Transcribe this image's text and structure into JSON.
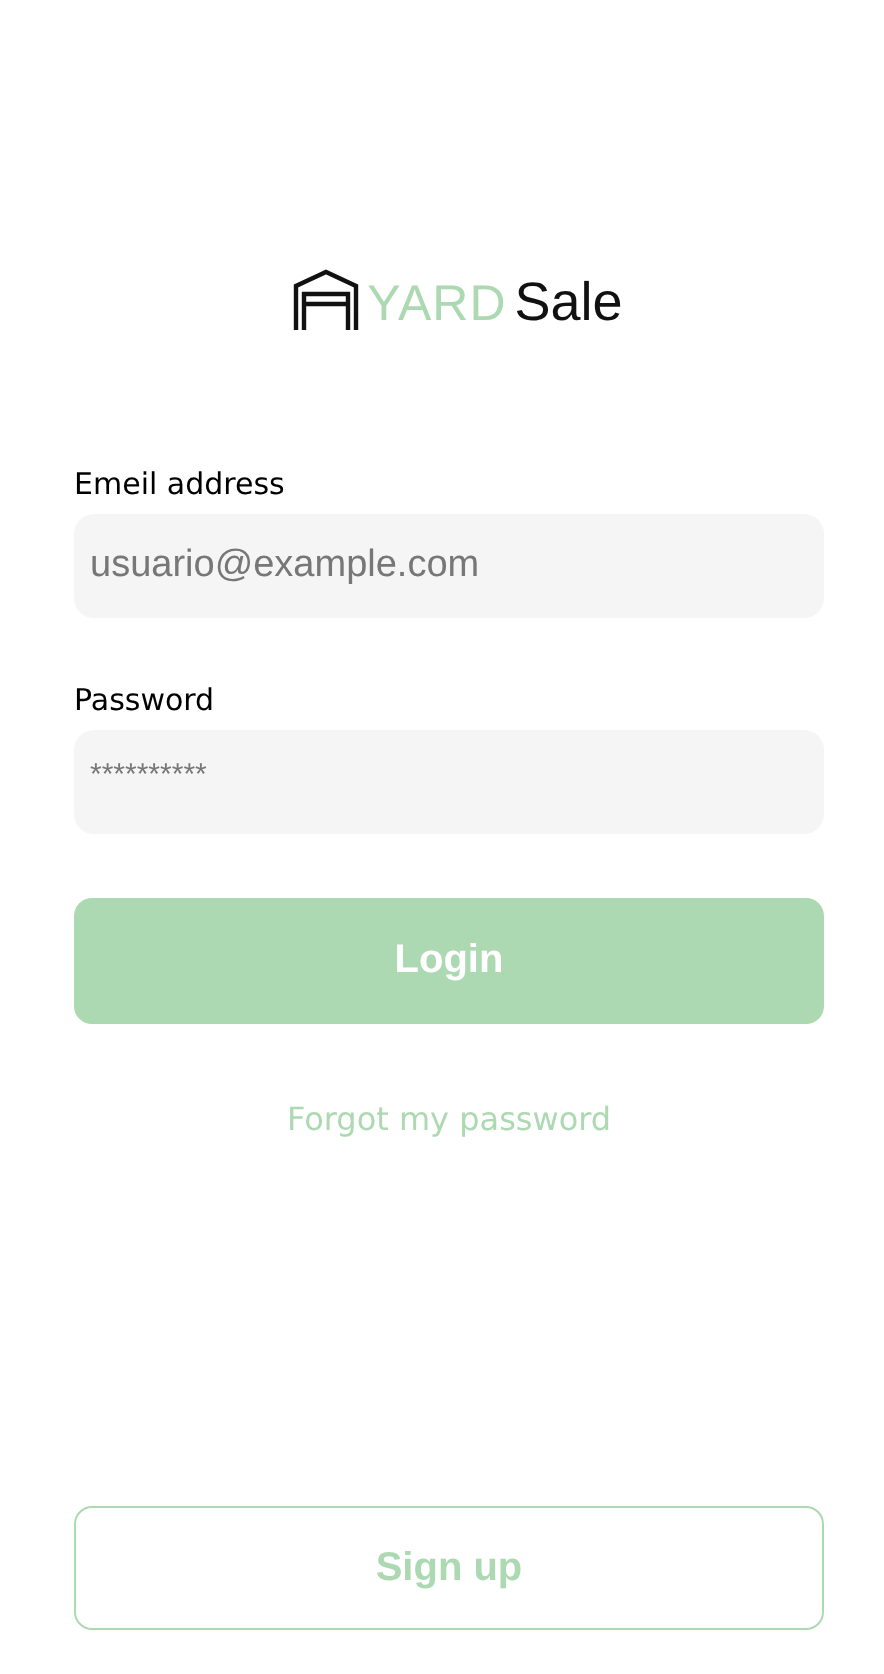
{
  "logo": {
    "accent": "YARD",
    "word": "Sale"
  },
  "fields": [
    {
      "label": "Emeil address",
      "placeholder": "usuario@example.com",
      "kind": "email"
    },
    {
      "label": "Password",
      "placeholder": "**********",
      "kind": "password"
    }
  ],
  "login_button": "Login",
  "forgot_link": "Forgot my password",
  "signup_button": "Sign up"
}
